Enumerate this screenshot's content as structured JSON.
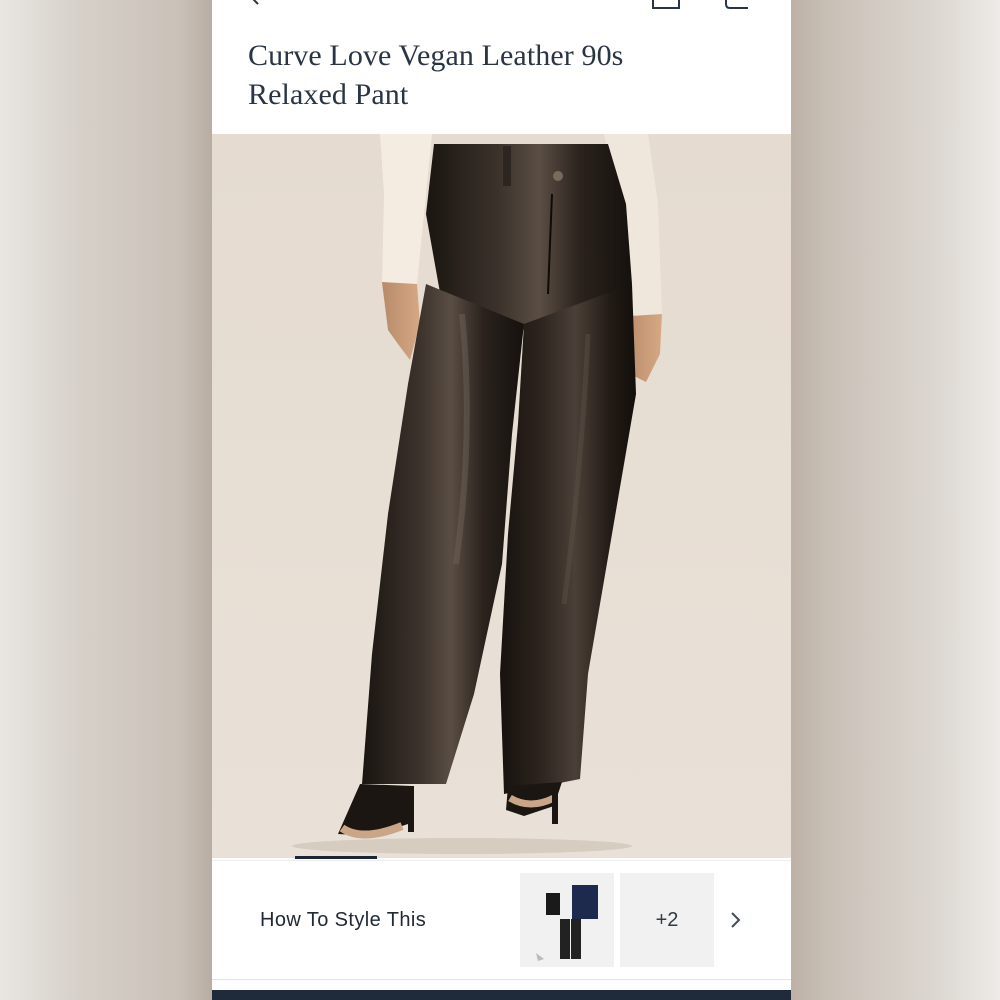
{
  "product": {
    "title_line1": "Curve Love Vegan Leather 90s",
    "title_line2": "Relaxed Pant"
  },
  "hero_image": {
    "description_icon": "product-photo"
  },
  "style_section": {
    "label": "How To Style This",
    "more_count": "+2"
  },
  "icons": {
    "back": "back-arrow-icon",
    "bag": "bag-icon",
    "cart": "cart-icon",
    "next": "chevron-right-icon"
  },
  "colors": {
    "title": "#2a3544",
    "accent_dark": "#1f2a3a",
    "photo_bg": "#e6ddd3"
  }
}
